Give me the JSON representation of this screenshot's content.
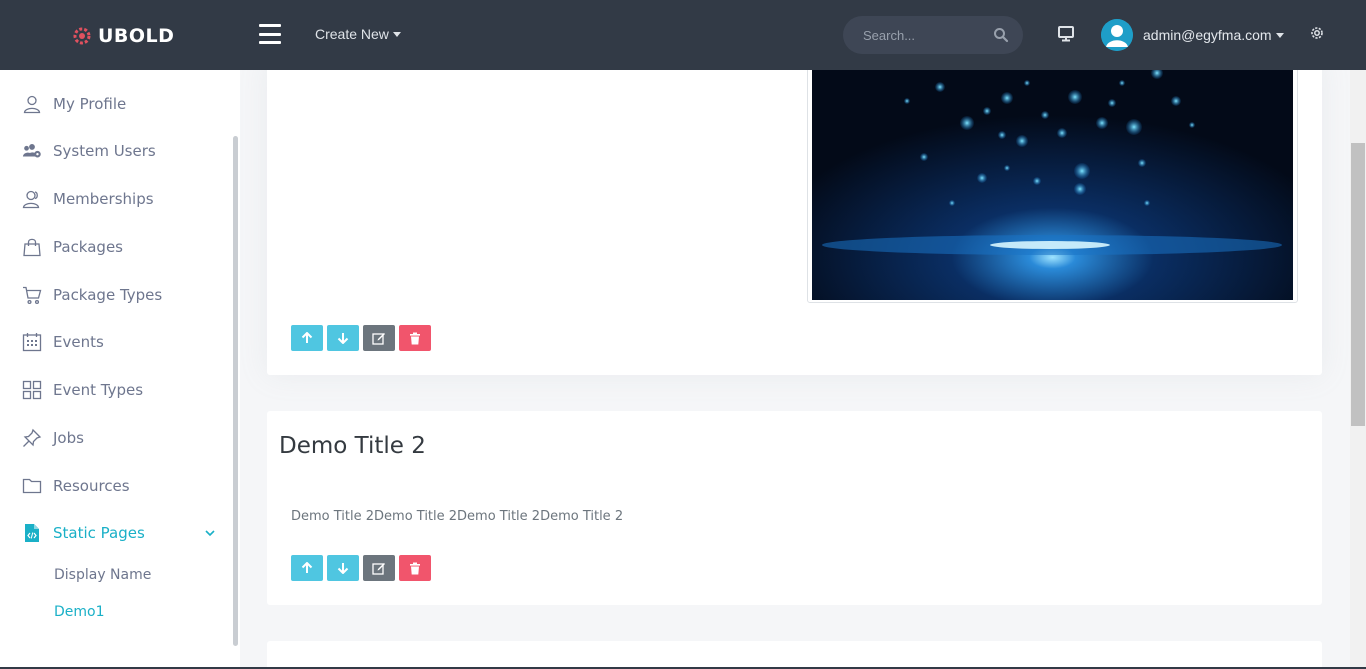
{
  "brand": {
    "name": "UBOLD",
    "accent": "#1ab0c7",
    "topbar_color": "#323a46"
  },
  "topbar": {
    "create_new": "Create New",
    "search_placeholder": "Search...",
    "user_email": "admin@egyfma.com"
  },
  "sidebar": {
    "items": [
      {
        "label": "My Profile",
        "icon": "user-icon"
      },
      {
        "label": "System Users",
        "icon": "users-cog-icon"
      },
      {
        "label": "Memberships",
        "icon": "user-group-icon"
      },
      {
        "label": "Packages",
        "icon": "shopping-bag-icon"
      },
      {
        "label": "Package Types",
        "icon": "cart-icon"
      },
      {
        "label": "Events",
        "icon": "calendar-icon"
      },
      {
        "label": "Event Types",
        "icon": "grid-icon"
      },
      {
        "label": "Jobs",
        "icon": "pin-icon"
      },
      {
        "label": "Resources",
        "icon": "folder-icon"
      },
      {
        "label": "Static Pages",
        "icon": "code-file-icon",
        "active": true,
        "expanded": true
      }
    ],
    "sub_items": [
      {
        "label": "Display Name",
        "active": false
      },
      {
        "label": "Demo1",
        "active": true
      }
    ]
  },
  "cards": [
    {
      "has_image": true,
      "image_alt": "blue bokeh particles"
    },
    {
      "title": "Demo Title 2",
      "text": "Demo Title 2Demo Title 2Demo Title 2Demo Title 2"
    }
  ],
  "actions": {
    "up": "arrow-up-icon",
    "down": "arrow-down-icon",
    "edit": "edit-icon",
    "delete": "trash-icon"
  }
}
